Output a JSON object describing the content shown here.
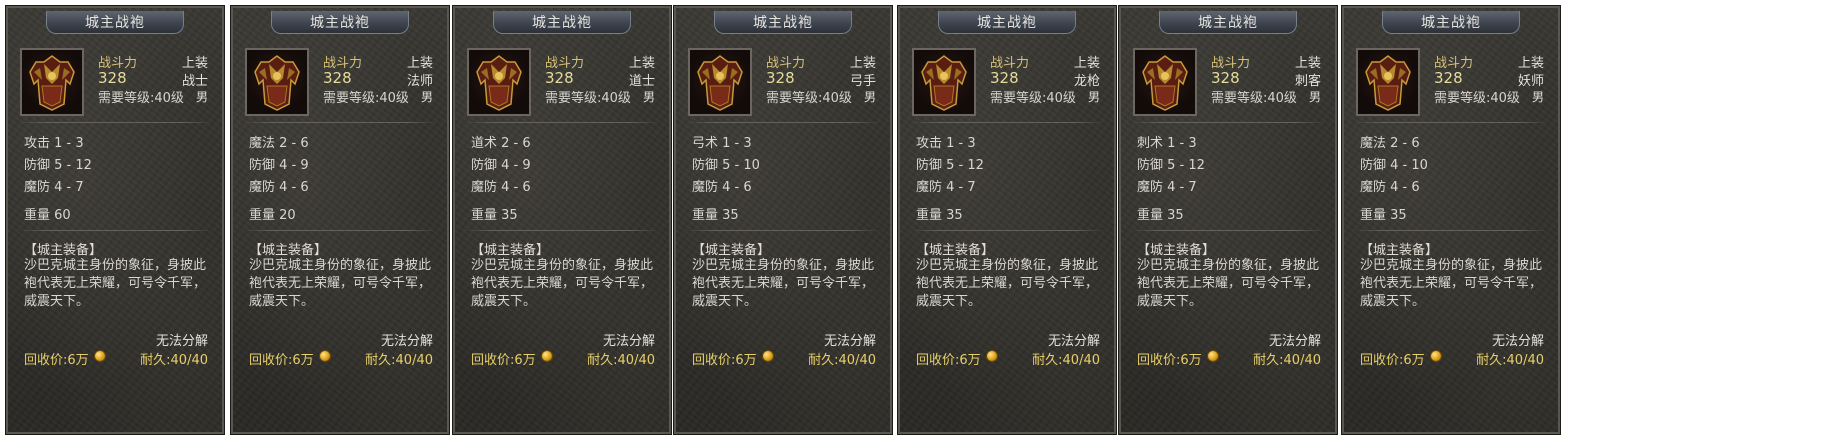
{
  "cards": [
    {
      "title": "城主战袍",
      "stat_name": "战斗力",
      "stat_value": "328",
      "requirement": "需要等级:40级",
      "slot": "上装",
      "class": "战士",
      "gender": "男",
      "attrs": [
        "攻击 1 - 3",
        "防御 5 - 12",
        "魔防 4 - 7"
      ],
      "weight": "重量 60",
      "set_name": "【城主装备】",
      "desc": "沙巴克城主身份的象征，身披此袍代表无上荣耀，可号令千军，威震天下。",
      "no_dismantle": "无法分解",
      "recycle": "回收价:6万",
      "durability": "耐久:40/40"
    },
    {
      "title": "城主战袍",
      "stat_name": "战斗力",
      "stat_value": "328",
      "requirement": "需要等级:40级",
      "slot": "上装",
      "class": "法师",
      "gender": "男",
      "attrs": [
        "魔法 2 - 6",
        "防御 4 - 9",
        "魔防 4 - 6"
      ],
      "weight": "重量 20",
      "set_name": "【城主装备】",
      "desc": "沙巴克城主身份的象征，身披此袍代表无上荣耀，可号令千军，威震天下。",
      "no_dismantle": "无法分解",
      "recycle": "回收价:6万",
      "durability": "耐久:40/40"
    },
    {
      "title": "城主战袍",
      "stat_name": "战斗力",
      "stat_value": "328",
      "requirement": "需要等级:40级",
      "slot": "上装",
      "class": "道士",
      "gender": "男",
      "attrs": [
        "道术 2 - 6",
        "防御 4 - 9",
        "魔防 4 - 6"
      ],
      "weight": "重量 35",
      "set_name": "【城主装备】",
      "desc": "沙巴克城主身份的象征，身披此袍代表无上荣耀，可号令千军，威震天下。",
      "no_dismantle": "无法分解",
      "recycle": "回收价:6万",
      "durability": "耐久:40/40"
    },
    {
      "title": "城主战袍",
      "stat_name": "战斗力",
      "stat_value": "328",
      "requirement": "需要等级:40级",
      "slot": "上装",
      "class": "弓手",
      "gender": "男",
      "attrs": [
        "弓术 1 - 3",
        "防御 5 - 10",
        "魔防 4 - 6"
      ],
      "weight": "重量 35",
      "set_name": "【城主装备】",
      "desc": "沙巴克城主身份的象征，身披此袍代表无上荣耀，可号令千军，威震天下。",
      "no_dismantle": "无法分解",
      "recycle": "回收价:6万",
      "durability": "耐久:40/40"
    },
    {
      "title": "城主战袍",
      "stat_name": "战斗力",
      "stat_value": "328",
      "requirement": "需要等级:40级",
      "slot": "上装",
      "class": "龙枪",
      "gender": "男",
      "attrs": [
        "攻击 1 - 3",
        "防御 5 - 12",
        "魔防 4 - 7"
      ],
      "weight": "重量 35",
      "set_name": "【城主装备】",
      "desc": "沙巴克城主身份的象征，身披此袍代表无上荣耀，可号令千军，威震天下。",
      "no_dismantle": "无法分解",
      "recycle": "回收价:6万",
      "durability": "耐久:40/40"
    },
    {
      "title": "城主战袍",
      "stat_name": "战斗力",
      "stat_value": "328",
      "requirement": "需要等级:40级",
      "slot": "上装",
      "class": "刺客",
      "gender": "男",
      "attrs": [
        "刺术 1 - 3",
        "防御 5 - 12",
        "魔防 4 - 7"
      ],
      "weight": "重量 35",
      "set_name": "【城主装备】",
      "desc": "沙巴克城主身份的象征，身披此袍代表无上荣耀，可号令千军，威震天下。",
      "no_dismantle": "无法分解",
      "recycle": "回收价:6万",
      "durability": "耐久:40/40"
    },
    {
      "title": "城主战袍",
      "stat_name": "战斗力",
      "stat_value": "328",
      "requirement": "需要等级:40级",
      "slot": "上装",
      "class": "妖师",
      "gender": "男",
      "attrs": [
        "魔法 2 - 6",
        "防御 4 - 10",
        "魔防 4 - 6"
      ],
      "weight": "重量 35",
      "set_name": "【城主装备】",
      "desc": "沙巴克城主身份的象征，身披此袍代表无上荣耀，可号令千军，威震天下。",
      "no_dismantle": "无法分解",
      "recycle": "回收价:6万",
      "durability": "耐久:40/40"
    }
  ],
  "icon": "armor-robe-icon",
  "colors": {
    "gold_text": "#e7cf6b",
    "panel_bg": "#302f2b",
    "title_plate": "#3f4550"
  }
}
